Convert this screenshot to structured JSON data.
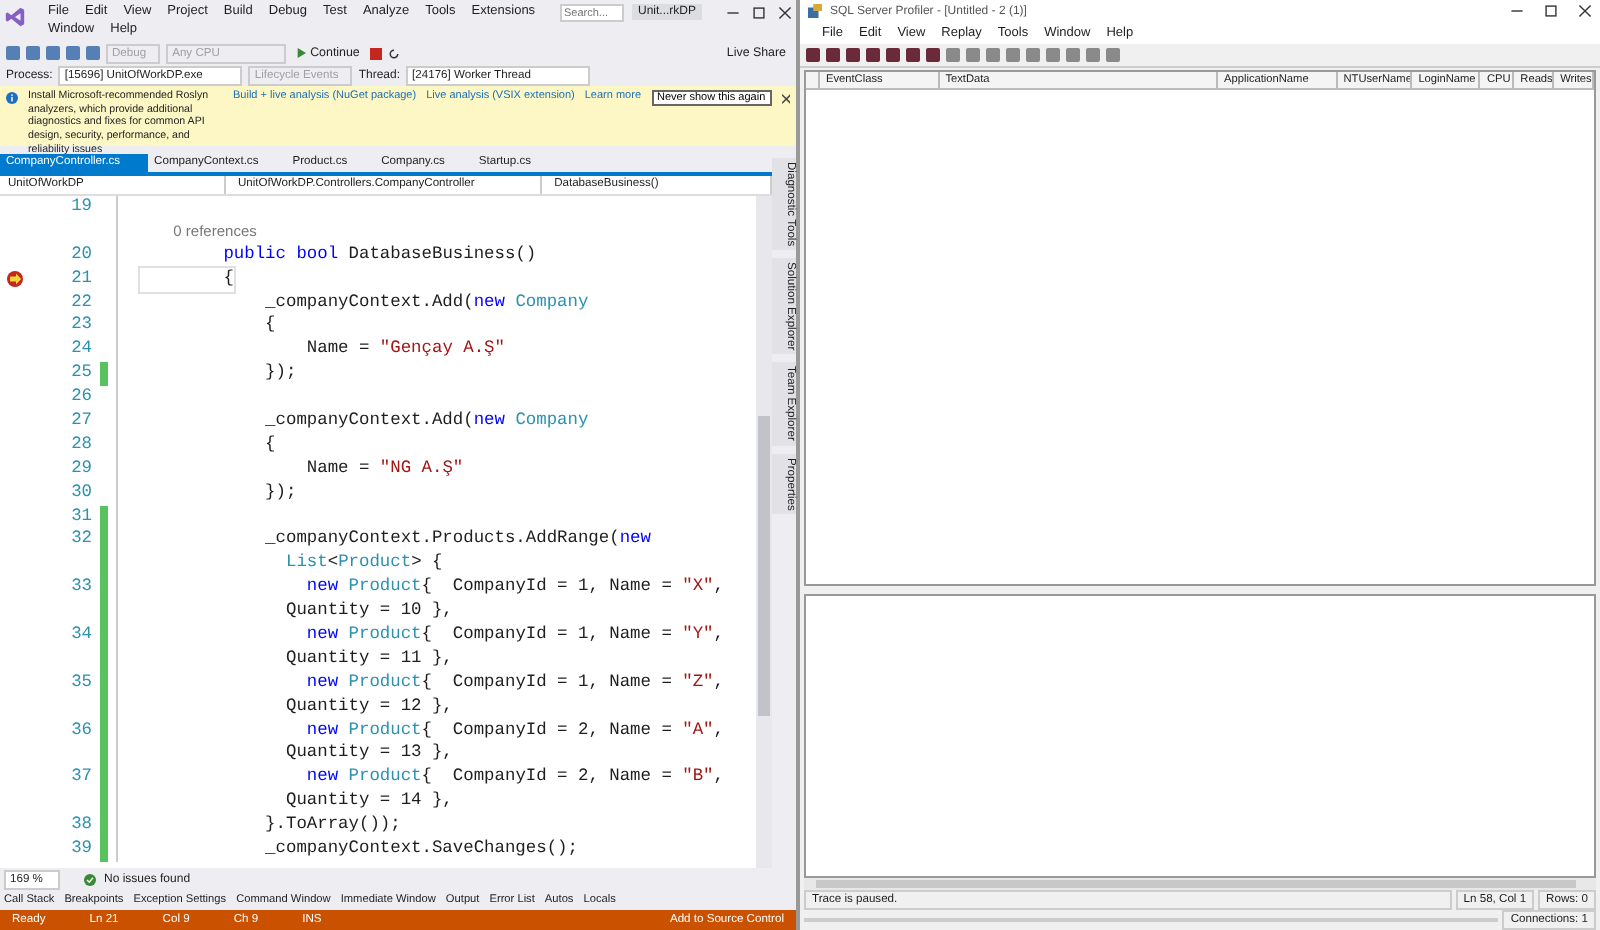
{
  "vs": {
    "menu": [
      "File",
      "Edit",
      "View",
      "Project",
      "Build",
      "Debug",
      "Test",
      "Analyze",
      "Tools",
      "Extensions",
      "Window",
      "Help"
    ],
    "search": {
      "placeholder": "Search..."
    },
    "solution_badge": "Unit...rkDP",
    "toolbar": {
      "config": "Debug",
      "platform": "Any CPU",
      "continue": "Continue",
      "live_share": "Live Share"
    },
    "process_bar": {
      "process_label": "Process:",
      "process": "[15696] UnitOfWorkDP.exe",
      "lifecycle": "Lifecycle Events",
      "thread_label": "Thread:",
      "thread": "[24176] Worker Thread"
    },
    "infobar": {
      "message": "Install Microsoft-recommended Roslyn analyzers, which provide additional diagnostics and fixes for common API design, security, performance, and reliability issues",
      "links": [
        "Build + live analysis (NuGet package)",
        "Live analysis (VSIX extension)",
        "Learn more"
      ],
      "button": "Never show this again"
    },
    "doc_tabs": [
      {
        "label": "CompanyController.cs",
        "selected": true
      },
      {
        "label": "CompanyContext.cs",
        "selected": false
      },
      {
        "label": "Product.cs",
        "selected": false
      },
      {
        "label": "Company.cs",
        "selected": false
      },
      {
        "label": "Startup.cs",
        "selected": false
      }
    ],
    "nav": [
      "UnitOfWorkDP",
      "UnitOfWorkDP.Controllers.CompanyController",
      "DatabaseBusiness()"
    ],
    "code": [
      {
        "kind": "line",
        "number": "19",
        "changed": false,
        "breakpoint": false
      },
      {
        "kind": "codelens",
        "text": "        0 references"
      },
      {
        "kind": "line",
        "number": "20",
        "changed": false,
        "breakpoint": false,
        "tokens": [
          {
            "kind": "keyword",
            "text": "        public "
          },
          {
            "kind": "keyword",
            "text": "bool "
          },
          {
            "kind": "plain",
            "text": "DatabaseBusiness()"
          }
        ]
      },
      {
        "kind": "line",
        "number": "21",
        "changed": false,
        "breakpoint": true,
        "tokens": [
          {
            "kind": "plain",
            "text": "        {"
          }
        ]
      },
      {
        "kind": "line",
        "number": "22",
        "changed": false,
        "breakpoint": false,
        "tokens": [
          {
            "kind": "plain",
            "text": "            _companyContext.Add("
          },
          {
            "kind": "keyword",
            "text": "new "
          },
          {
            "kind": "type",
            "text": "Company"
          }
        ]
      },
      {
        "kind": "line",
        "number": "23",
        "changed": false,
        "breakpoint": false,
        "tokens": [
          {
            "kind": "plain",
            "text": "            {"
          }
        ]
      },
      {
        "kind": "line",
        "number": "24",
        "changed": false,
        "breakpoint": false,
        "tokens": [
          {
            "kind": "plain",
            "text": "                Name = "
          },
          {
            "kind": "string",
            "text": "\"Gençay A.Ş\""
          }
        ]
      },
      {
        "kind": "line",
        "number": "25",
        "changed": true,
        "breakpoint": false,
        "tokens": [
          {
            "kind": "plain",
            "text": "            });"
          }
        ]
      },
      {
        "kind": "line",
        "number": "26",
        "changed": false,
        "breakpoint": false
      },
      {
        "kind": "line",
        "number": "27",
        "changed": false,
        "breakpoint": false,
        "tokens": [
          {
            "kind": "plain",
            "text": "            _companyContext.Add("
          },
          {
            "kind": "keyword",
            "text": "new "
          },
          {
            "kind": "type",
            "text": "Company"
          }
        ]
      },
      {
        "kind": "line",
        "number": "28",
        "changed": false,
        "breakpoint": false,
        "tokens": [
          {
            "kind": "plain",
            "text": "            {"
          }
        ]
      },
      {
        "kind": "line",
        "number": "29",
        "changed": false,
        "breakpoint": false,
        "tokens": [
          {
            "kind": "plain",
            "text": "                Name = "
          },
          {
            "kind": "string",
            "text": "\"NG A.Ş\""
          }
        ]
      },
      {
        "kind": "line",
        "number": "30",
        "changed": false,
        "breakpoint": false,
        "tokens": [
          {
            "kind": "plain",
            "text": "            });"
          }
        ]
      },
      {
        "kind": "line",
        "number": "31",
        "changed": true,
        "breakpoint": false
      },
      {
        "kind": "line",
        "number": "32",
        "changed": true,
        "breakpoint": false,
        "tokens": [
          {
            "kind": "plain",
            "text": "            _companyContext.Products.AddRange("
          },
          {
            "kind": "keyword",
            "text": "new"
          }
        ]
      },
      {
        "kind": "line",
        "changed": true,
        "breakpoint": false,
        "tokens": [
          {
            "kind": "type",
            "text": "              List"
          },
          {
            "kind": "plain",
            "text": "<"
          },
          {
            "kind": "type",
            "text": "Product"
          },
          {
            "kind": "plain",
            "text": "> {"
          }
        ]
      },
      {
        "kind": "line",
        "number": "33",
        "changed": true,
        "breakpoint": false,
        "tokens": [
          {
            "kind": "keyword",
            "text": "                new "
          },
          {
            "kind": "type",
            "text": "Product"
          },
          {
            "kind": "plain",
            "text": "{  CompanyId = 1, Name = "
          },
          {
            "kind": "string",
            "text": "\"X\""
          },
          {
            "kind": "plain",
            "text": ","
          }
        ]
      },
      {
        "kind": "line",
        "changed": true,
        "breakpoint": false,
        "tokens": [
          {
            "kind": "plain",
            "text": "              Quantity = 10 },"
          }
        ]
      },
      {
        "kind": "line",
        "number": "34",
        "changed": true,
        "breakpoint": false,
        "tokens": [
          {
            "kind": "keyword",
            "text": "                new "
          },
          {
            "kind": "type",
            "text": "Product"
          },
          {
            "kind": "plain",
            "text": "{  CompanyId = 1, Name = "
          },
          {
            "kind": "string",
            "text": "\"Y\""
          },
          {
            "kind": "plain",
            "text": ","
          }
        ]
      },
      {
        "kind": "line",
        "changed": true,
        "breakpoint": false,
        "tokens": [
          {
            "kind": "plain",
            "text": "              Quantity = 11 },"
          }
        ]
      },
      {
        "kind": "line",
        "number": "35",
        "changed": true,
        "breakpoint": false,
        "tokens": [
          {
            "kind": "keyword",
            "text": "                new "
          },
          {
            "kind": "type",
            "text": "Product"
          },
          {
            "kind": "plain",
            "text": "{  CompanyId = 1, Name = "
          },
          {
            "kind": "string",
            "text": "\"Z\""
          },
          {
            "kind": "plain",
            "text": ","
          }
        ]
      },
      {
        "kind": "line",
        "changed": true,
        "breakpoint": false,
        "tokens": [
          {
            "kind": "plain",
            "text": "              Quantity = 12 },"
          }
        ]
      },
      {
        "kind": "line",
        "number": "36",
        "changed": true,
        "breakpoint": false,
        "tokens": [
          {
            "kind": "keyword",
            "text": "                new "
          },
          {
            "kind": "type",
            "text": "Product"
          },
          {
            "kind": "plain",
            "text": "{  CompanyId = 2, Name = "
          },
          {
            "kind": "string",
            "text": "\"A\""
          },
          {
            "kind": "plain",
            "text": ","
          }
        ]
      },
      {
        "kind": "line",
        "changed": true,
        "breakpoint": false,
        "tokens": [
          {
            "kind": "plain",
            "text": "              Quantity = 13 },"
          }
        ]
      },
      {
        "kind": "line",
        "number": "37",
        "changed": true,
        "breakpoint": false,
        "tokens": [
          {
            "kind": "keyword",
            "text": "                new "
          },
          {
            "kind": "type",
            "text": "Product"
          },
          {
            "kind": "plain",
            "text": "{  CompanyId = 2, Name = "
          },
          {
            "kind": "string",
            "text": "\"B\""
          },
          {
            "kind": "plain",
            "text": ","
          }
        ]
      },
      {
        "kind": "line",
        "changed": true,
        "breakpoint": false,
        "tokens": [
          {
            "kind": "plain",
            "text": "              Quantity = 14 },"
          }
        ]
      },
      {
        "kind": "line",
        "number": "38",
        "changed": true,
        "breakpoint": false,
        "tokens": [
          {
            "kind": "plain",
            "text": "            }.ToArray());"
          }
        ]
      },
      {
        "kind": "line",
        "number": "39",
        "changed": true,
        "breakpoint": false,
        "tokens": [
          {
            "kind": "plain",
            "text": "            _companyContext.SaveChanges();"
          }
        ]
      }
    ],
    "zoom": "169 %",
    "issues": "No issues found",
    "tool_tabs": [
      "Call Stack",
      "Breakpoints",
      "Exception Settings",
      "Command Window",
      "Immediate Window",
      "Output",
      "Error List",
      "Autos",
      "Locals"
    ],
    "status": {
      "ready": "Ready",
      "ln": "Ln 21",
      "col": "Col 9",
      "ch": "Ch 9",
      "mode": "INS",
      "source": "Add to Source Control"
    },
    "side_tabs": [
      "Diagnostic Tools",
      "Solution Explorer",
      "Team Explorer",
      "Properties"
    ]
  },
  "profiler": {
    "title": "SQL Server Profiler - [Untitled - 2 (1)]",
    "menu": [
      "File",
      "Edit",
      "View",
      "Replay",
      "Tools",
      "Window",
      "Help"
    ],
    "columns": [
      "EventClass",
      "TextData",
      "ApplicationName",
      "NTUserName",
      "LoginName",
      "CPU",
      "Reads",
      "Writes"
    ],
    "status": "Trace is paused.",
    "position": "Ln 58, Col 1",
    "rows": "Rows: 0",
    "connections": "Connections: 1"
  }
}
